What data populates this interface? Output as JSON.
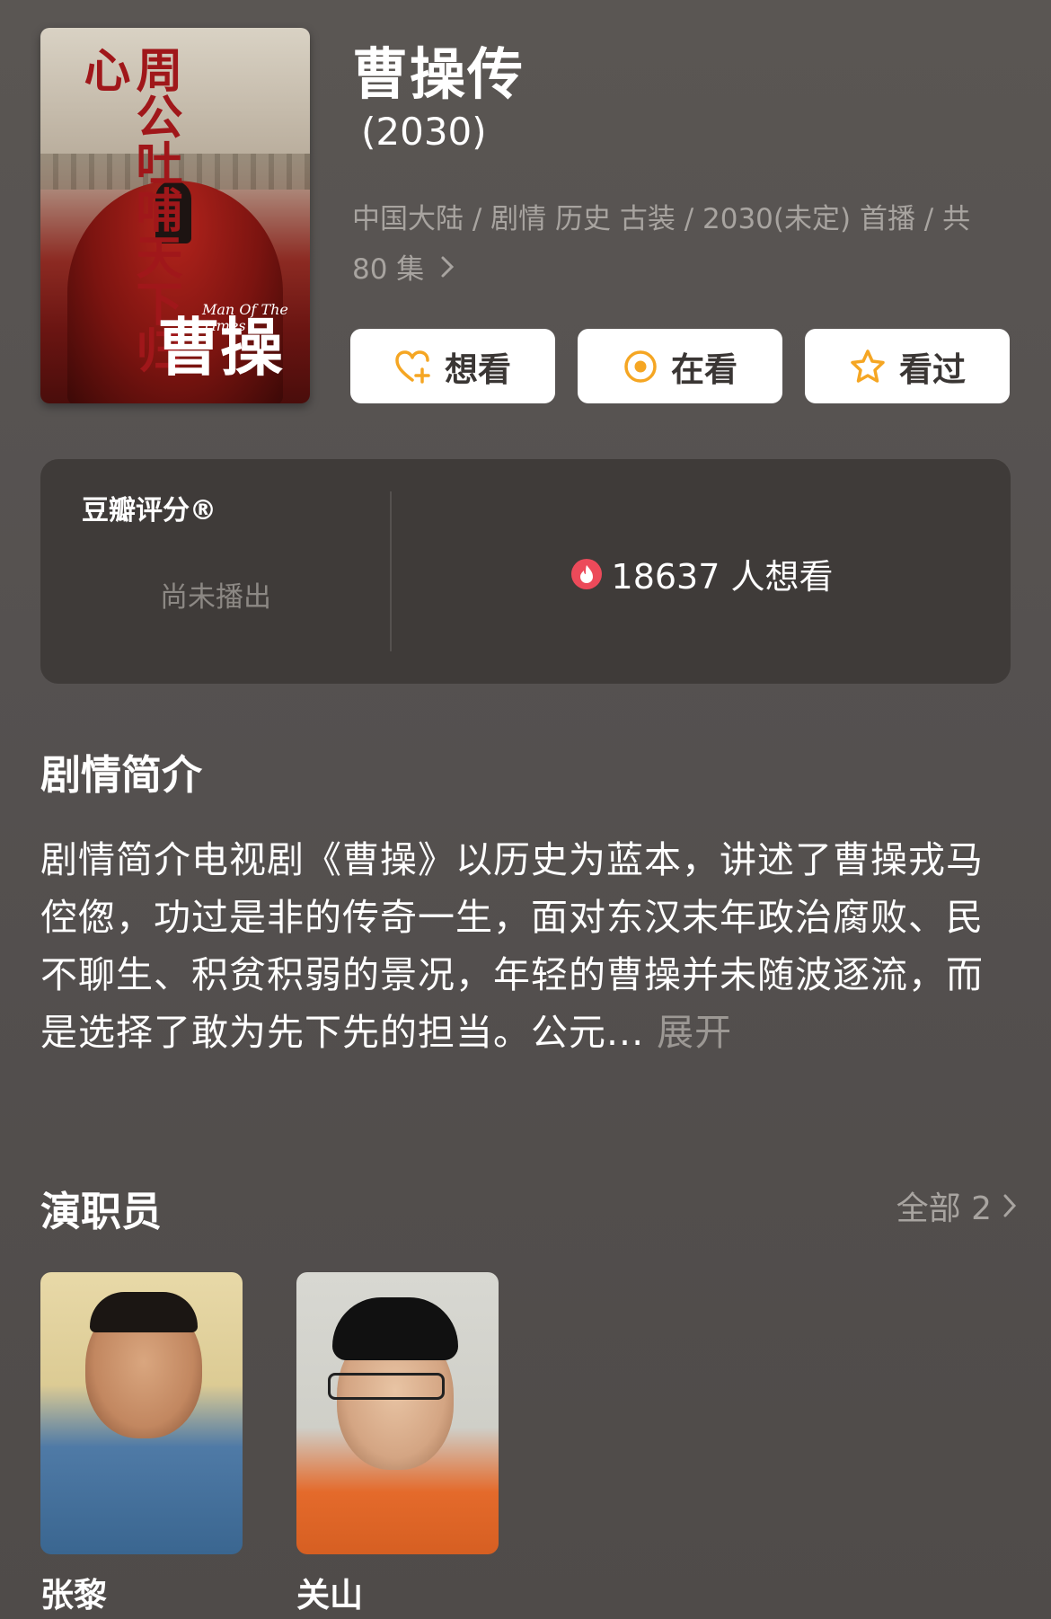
{
  "show": {
    "title": "曹操传",
    "year": "(2030)",
    "meta_line": "中国大陆 / 剧情 历史 古装 / 2030(未定) 首播 / 共 80 集",
    "poster": {
      "calligraphy_top": "周公吐哺天下归心",
      "calligraphy_title": "曹操",
      "english_title": "Man Of The Times"
    }
  },
  "actions": {
    "want": "想看",
    "watching": "在看",
    "watched": "看过"
  },
  "rating": {
    "label": "豆瓣评分®",
    "status": "尚未播出",
    "wish_count": "18637 人想看"
  },
  "synopsis": {
    "title": "剧情简介",
    "text": "剧情简介电视剧《曹操》以历史为蓝本，讲述了曹操戎马倥偬，功过是非的传奇一生，面对东汉末年政治腐败、民不聊生、积贫积弱的景况，年轻的曹操并未随波逐流，而是选择了敢为先下先的担当。公元... ",
    "expand": "展开"
  },
  "cast": {
    "title": "演职员",
    "all_label": "全部 2",
    "members": [
      {
        "name": "张黎"
      },
      {
        "name": "关山"
      }
    ]
  },
  "colors": {
    "background": "#555150",
    "card": "#3f3b39",
    "accent_orange": "#f5a623",
    "fire_red": "#ec4a5a",
    "muted_text": "#a8a4a0"
  },
  "icons": {
    "want": "heart-plus-icon",
    "watching": "target-circle-icon",
    "watched": "star-outline-icon",
    "wish": "fire-icon",
    "chevron": "chevron-right-icon"
  }
}
